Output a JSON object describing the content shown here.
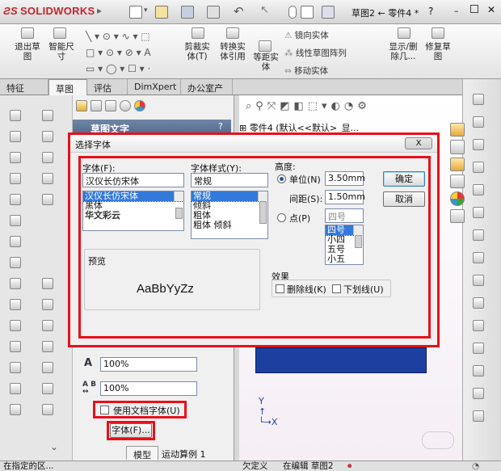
{
  "app": {
    "logo": "SOLIDWORKS",
    "title": "草图2 ← 零件4 *",
    "help_icon": "?"
  },
  "command_bar": {
    "large": [
      {
        "label": "退出草\n图"
      },
      {
        "label": "智能尺\n寸"
      },
      {
        "label": "剪裁实\n体(T)"
      },
      {
        "label": "转换实\n体引用"
      },
      {
        "label": "等距实\n体"
      },
      {
        "label": "显示/删\n除几..."
      },
      {
        "label": "修复草\n图"
      }
    ],
    "small": [
      "镜向实体",
      "线性草图阵列",
      "移动实体"
    ]
  },
  "tabs": [
    "特征",
    "草图",
    "评估",
    "DimXpert",
    "办公室产品"
  ],
  "panel": {
    "title": "草图文字",
    "help": "?",
    "close": "×",
    "width_label": "100%",
    "spacing_label": "100%",
    "use_doc_font": "使用文档字体(U)",
    "font_button": "字体(F)...",
    "bottom_tabs": [
      "模型",
      "运动算例 1"
    ]
  },
  "tree": {
    "node": "零件4 (默认<<默认>_显..."
  },
  "dialog": {
    "title": "选择字体",
    "close": "X",
    "font_label": "字体(F):",
    "font_value": "汉仪长仿宋体",
    "font_list": [
      "汉仪长仿宋体",
      "黑体",
      "华文彩云"
    ],
    "style_label": "字体样式(Y):",
    "style_value": "常规",
    "style_list": [
      "常规",
      "倾斜",
      "粗体",
      "粗体 倾斜"
    ],
    "height_label": "高度:",
    "unit_label": "单位(N)",
    "unit_value": "3.50mm",
    "spacing_label": "间距(S):",
    "spacing_value": "1.50mm",
    "point_label": "点(P)",
    "point_value": "四号",
    "point_list": [
      "四号",
      "小四",
      "五号",
      "小五"
    ],
    "ok": "确定",
    "cancel": "取消",
    "preview_label": "预览",
    "preview_text": "AaBbYyZz",
    "effects_label": "效果",
    "strikeout": "删除线(K)",
    "underline": "下划线(U)"
  },
  "status": {
    "left": "在指定的区...",
    "mid1": "欠定义",
    "mid2": "在编辑 草图2"
  },
  "colors": {
    "accent_red": "#e8101a",
    "selection": "#3379d9",
    "model_blue": "#1d3fa0"
  }
}
